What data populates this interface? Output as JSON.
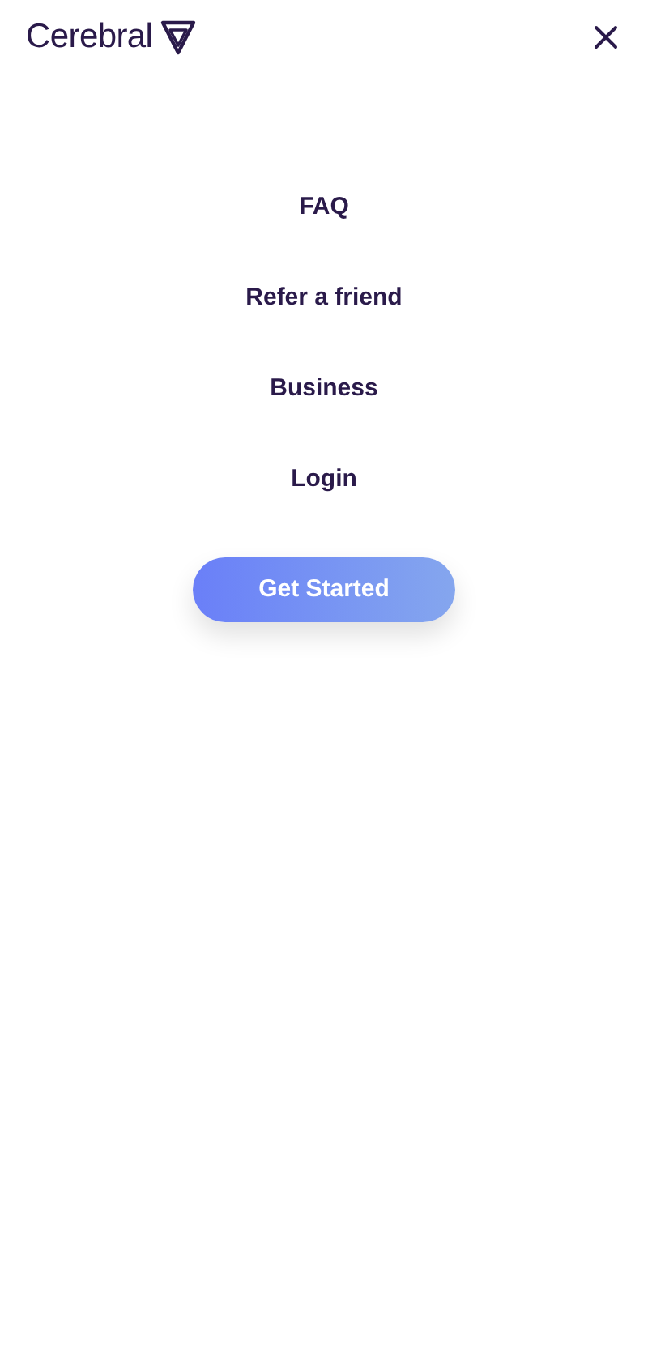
{
  "header": {
    "logo_text": "Cerebral"
  },
  "menu_items": [
    "FAQ",
    "Refer a friend",
    "Business",
    "Login"
  ],
  "cta_button": "Get Started"
}
